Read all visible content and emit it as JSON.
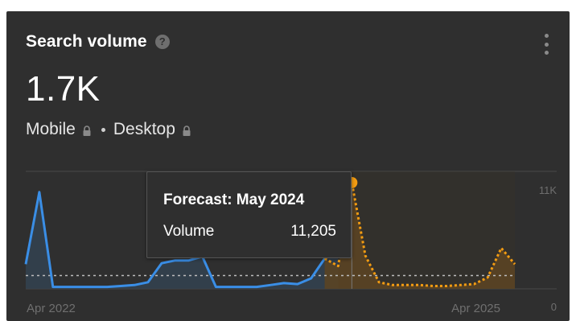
{
  "widget": {
    "title": "Search volume",
    "help_icon": "question-circle-icon",
    "menu_icon": "kebab-menu-icon",
    "value": "1.7K",
    "devices": {
      "mobile_label": "Mobile",
      "desktop_label": "Desktop",
      "lock_icon": "lock-icon"
    }
  },
  "tooltip": {
    "title": "Forecast: May 2024",
    "label": "Volume",
    "value": "11,205"
  },
  "chart_data": {
    "type": "line",
    "x_start_label": "Apr 2022",
    "x_end_label": "Apr 2025",
    "y_max_label": "11K",
    "y_min_label": "0",
    "ylim": [
      0,
      11205
    ],
    "colors": {
      "historical": "#3a8ee6",
      "forecast": "#f39c12",
      "forecast_fill": "#5a4423",
      "historical_fill": "#33414f",
      "avg_line": "#bdbdbd",
      "grid": "#4a4a4a",
      "axis_text": "#6f6f6f"
    },
    "series": [
      {
        "values": [
          2600,
          10200,
          200,
          200,
          200,
          200,
          200,
          300,
          400,
          700,
          2700,
          3000,
          3000,
          3400,
          200,
          200,
          200,
          200,
          400,
          600,
          500,
          1100,
          3200,
          7000
        ]
      },
      {
        "start_index": 22,
        "values": [
          3200,
          2400,
          11205,
          3500,
          700,
          400,
          400,
          400,
          300,
          300,
          400,
          500,
          1200,
          4300,
          2600
        ]
      }
    ],
    "average": 1400,
    "highlight_index": 24
  }
}
